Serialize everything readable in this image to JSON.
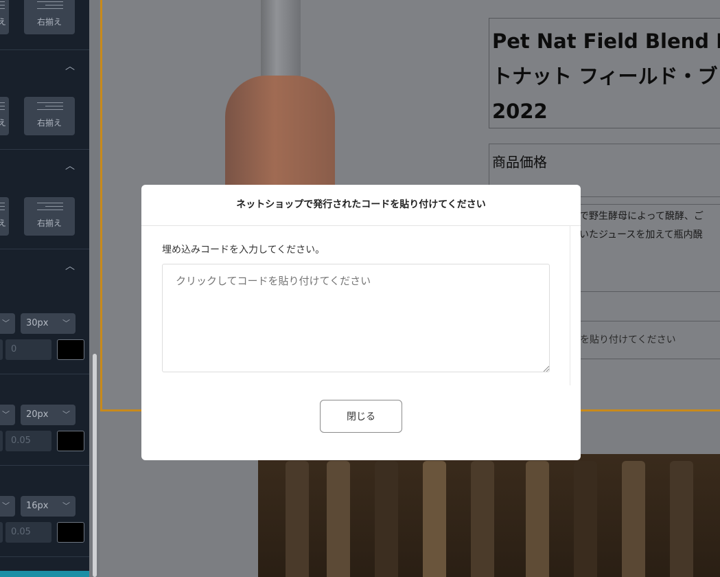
{
  "sidebar": {
    "align_right_label": "右揃え",
    "align_partial_label": "え",
    "font_size_1": "30px",
    "font_size_2": "20px",
    "font_size_3": "16px",
    "letter_spacing_1_placeholder": "0",
    "letter_spacing_2_placeholder": "0.05",
    "letter_spacing_3_placeholder": "0.05",
    "color_swatch": "#000000"
  },
  "page": {
    "product_title_line1": "Pet Nat Field Blend Rosé",
    "product_title_line2": "トナット フィールド・ブレンド",
    "product_title_line3": "2022",
    "price_label": "商品価格",
    "desc_line1": "で野生酵母によって醗酵、ご",
    "desc_line2": "いたジュースを加えて瓶内醗",
    "embed_placeholder": "を貼り付けてください"
  },
  "modal": {
    "title": "ネットショップで発行されたコードを貼り付けてください",
    "label": "埋め込みコードを入力してください。",
    "textarea_placeholder": "クリックしてコードを貼り付けてください",
    "close_label": "閉じる"
  },
  "colors": {
    "accent_border": "#c98a1a",
    "sidebar_bg": "#18202b",
    "teal": "#1a8fa5"
  }
}
